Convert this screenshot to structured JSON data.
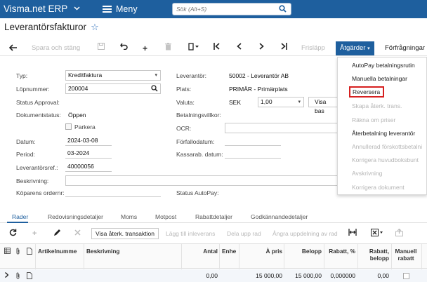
{
  "app": {
    "brand": "Visma.net ERP",
    "menu_label": "Meny",
    "search_placeholder": "Sök (Alt+S)"
  },
  "page": {
    "title": "Leverantörsfakturor"
  },
  "toolbar": {
    "save_close": "Spara och stäng",
    "release": "Frisläpp",
    "actions": "Åtgärder",
    "inquiries": "Förfrågningar"
  },
  "form": {
    "typ_label": "Typ:",
    "typ_value": "Kreditfaktura",
    "lopnummer_label": "Löpnummer:",
    "lopnummer_value": "200004",
    "status_approval_label": "Status Approval:",
    "dokumentstatus_label": "Dokumentstatus:",
    "dokumentstatus_value": "Öppen",
    "parkera_label": "Parkera",
    "datum_label": "Datum:",
    "datum_value": "2024-03-08",
    "period_label": "Period:",
    "period_value": "03-2024",
    "leverantorsref_label": "Leverantörsref.:",
    "leverantorsref_value": "40000056",
    "beskrivning_label": "Beskrivning:",
    "koparens_label": "Köparens ordernr:",
    "leverantor_label": "Leverantör:",
    "leverantor_value": "50002 - Leverantör AB",
    "plats_label": "Plats:",
    "plats_value": "PRIMÄR - Primärplats",
    "valuta_label": "Valuta:",
    "valuta_code": "SEK",
    "valuta_rate": "1,00",
    "visa_bas_label": "Visa bas",
    "betalningsvillkor_label": "Betalningsvillkor:",
    "ocr_label": "OCR:",
    "forfallodatum_label": "Förfallodatum:",
    "kassarab_label": "Kassarab. datum:",
    "status_autopay_label": "Status AutoPay:"
  },
  "actions_menu": {
    "items": [
      {
        "label": "AutoPay betalningsrutin",
        "enabled": true
      },
      {
        "label": "Manuella betalningar",
        "enabled": true
      },
      {
        "label": "Reversera",
        "enabled": true,
        "highlighted": true
      },
      {
        "label": "Skapa återk. trans.",
        "enabled": false
      },
      {
        "label": "Räkna om priser",
        "enabled": false
      },
      {
        "label": "Återbetalning leverantör",
        "enabled": true
      },
      {
        "label": "Annullerad förskottsbetalni",
        "enabled": false
      },
      {
        "label": "Korrigera huvudboksbunt",
        "enabled": false
      },
      {
        "label": "Avskrivning",
        "enabled": false
      },
      {
        "label": "Korrigera dokument",
        "enabled": false
      }
    ],
    "highlight_color": "#d62020"
  },
  "tabs": [
    "Rader",
    "Redovisningsdetaljer",
    "Moms",
    "Motpost",
    "Rabattdetaljer",
    "Godkännandedetaljer"
  ],
  "grid_toolbar": {
    "show_recurring": "Visa återk. transaktion",
    "add_to_receipt": "Lägg till inleverans",
    "split_row": "Dela upp rad",
    "undo_split": "Ångra uppdelning av rad"
  },
  "grid": {
    "columns": {
      "artikelnummer": "Artikelnumme",
      "beskrivning": "Beskrivning",
      "antal": "Antal",
      "enhet": "Enhe",
      "a_pris": "À pris",
      "belopp": "Belopp",
      "rabatt_pct": "Rabatt, %",
      "rabatt_belopp": "Rabatt, belopp",
      "manuell_rabatt": "Manuell rabatt"
    },
    "rows": [
      {
        "antal": "0,00",
        "a_pris": "15 000,00",
        "belopp": "15 000,00",
        "rabatt_pct": "0,000000",
        "rabatt_belopp": "0,00"
      }
    ]
  },
  "colors": {
    "brand_blue": "#1e5f9e",
    "highlight_red": "#d62020"
  }
}
